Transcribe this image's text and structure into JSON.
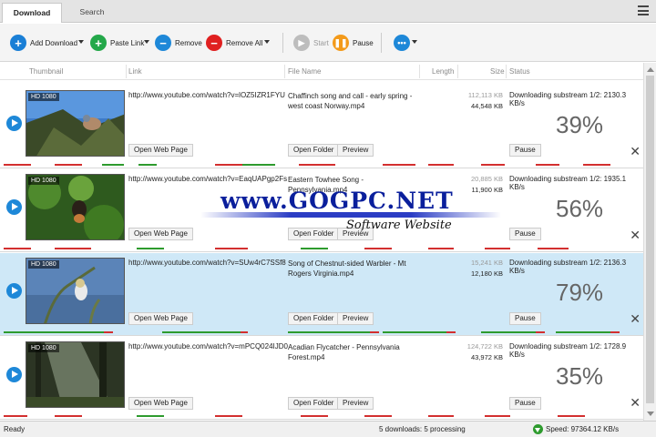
{
  "tabs": {
    "download": "Download",
    "search": "Search"
  },
  "toolbar": {
    "add_download": "Add Download",
    "paste_link": "Paste Link",
    "remove": "Remove",
    "remove_all": "Remove All",
    "start": "Start",
    "pause": "Pause"
  },
  "columns": {
    "thumbnail": "Thumbnail",
    "link": "Link",
    "file_name": "File Name",
    "length": "Length",
    "size": "Size",
    "status": "Status"
  },
  "buttons": {
    "open_web_page": "Open Web Page",
    "open_folder": "Open Folder",
    "preview": "Preview",
    "pause": "Pause"
  },
  "downloads": [
    {
      "badge": "HD 1080",
      "link": "http://www.youtube.com/watch?v=lOZ5IZR1FYU",
      "file_name": "Chaffinch song and call - early spring - west coast Norway.mp4",
      "size_total": "112,113 KB",
      "size_done": "44,548 KB",
      "status": "Downloading substream 1/2: 2130.3 KB/s",
      "percent": "39%",
      "selected": false
    },
    {
      "badge": "HD 1080",
      "link": "http://www.youtube.com/watch?v=EaqUAPgp2Fs",
      "file_name": "Eastern Towhee Song - Pennsylvania.mp4",
      "size_total": "20,885 KB",
      "size_done": "11,900 KB",
      "status": "Downloading substream 1/2: 1935.1 KB/s",
      "percent": "56%",
      "selected": false
    },
    {
      "badge": "HD 1080",
      "link": "http://www.youtube.com/watch?v=SUw4rC7SSf8",
      "file_name": "Song of Chestnut-sided Warbler - Mt Rogers Virginia.mp4",
      "size_total": "15,241 KB",
      "size_done": "12,180 KB",
      "status": "Downloading substream 1/2: 2136.3 KB/s",
      "percent": "79%",
      "selected": true
    },
    {
      "badge": "HD 1080",
      "link": "http://www.youtube.com/watch?v=mPCQ024IJD0",
      "file_name": "Acadian Flycatcher - Pennsylvania Forest.mp4",
      "size_total": "124,722 KB",
      "size_done": "43,972 KB",
      "status": "Downloading substream 1/2: 1728.9 KB/s",
      "percent": "35%",
      "selected": false
    }
  ],
  "statusbar": {
    "left": "Ready",
    "center": "5 downloads: 5 processing",
    "speed": "Speed: 97364.12 KB/s"
  },
  "watermark": {
    "title": "www.GOGPC.NET",
    "subtitle": "Software Website"
  },
  "colors": {
    "add": "#1a7fd6",
    "paste": "#24a84a",
    "remove": "#1e88d8",
    "remove_all": "#e02020",
    "start": "#bdbdbd",
    "pause": "#f39a1a",
    "more": "#1e88d8",
    "selected_row": "#cfe8f7"
  }
}
